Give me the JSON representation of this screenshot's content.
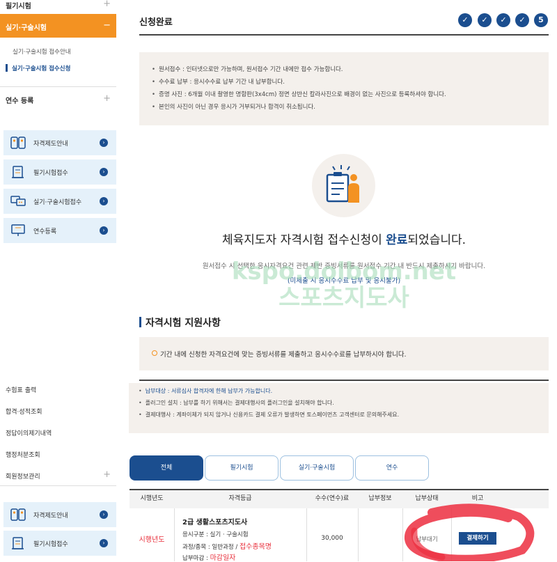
{
  "sidebar": {
    "written_exam": "필기시험",
    "practical_exam": "실기·구술시험",
    "practical_collapse": "−",
    "sub_guide": "실기·구술시험 접수안내",
    "sub_apply": "실기·구술시험 접수신청",
    "training_reg": "연수 등록",
    "cards": [
      {
        "label": "자격제도안내",
        "icon": "id-card-icon"
      },
      {
        "label": "필기시험접수",
        "icon": "document-icon"
      },
      {
        "label": "실기·구술시험접수",
        "icon": "chat-icon"
      },
      {
        "label": "연수등록",
        "icon": "monitor-icon"
      }
    ],
    "links": [
      "수험표 출력",
      "합격·성적조회",
      "정답이의제기내역",
      "행정처분조회",
      "회원정보관리"
    ],
    "cards2": [
      {
        "label": "자격제도안내",
        "icon": "id-card-icon"
      },
      {
        "label": "필기시험접수",
        "icon": "document-icon"
      }
    ]
  },
  "header": {
    "title": "신청완료",
    "steps": [
      "✓",
      "✓",
      "✓",
      "✓",
      "5"
    ]
  },
  "notice": [
    "원서접수 : 인터넷으로만 가능하며, 원서접수 기간 내에만 접수 가능합니다.",
    "수수료 납부 : 응시수수료 납부 기간 내 납부합니다.",
    "증명 사진 : 6개월 이내 촬영한 명함판(3x4cm) 정면 상반신 칼라사진으로 배경이 없는 사진으로 등록하셔야 합니다.",
    "본인의 사진이 아닌 경우 응시가 거부되거나 합격이 취소됩니다."
  ],
  "complete": {
    "pre": "체육지도자 자격시험 접수신청이 ",
    "highlight": "완료",
    "post": "되었습니다.",
    "desc": "원서접수 시 선택한 응시자격요건 관련 제반 증빙서류를 원서접수 기간 내 반드시 제출하시기 바랍니다.",
    "warn": "(미제출 시 응시수수료 납부 및 응시불가)"
  },
  "watermark": {
    "line1": "kspo.dolbom.net",
    "line2": "스포츠지도사"
  },
  "section": {
    "title": "자격시험 지원사항",
    "notice": "기간 내에 신청한 자격요건에 맞는 증빙서류를 제출하고 응시수수료를 납부하시야 합니다."
  },
  "notice2": [
    "납부대상 : 서류심사 합격자에 한해 납부가 가능합니다.",
    "플러그인 설치 : 납부를 하기 위해서는 결제대행사의 플러그인을 설치해야 합니다.",
    "결제대행사 : 계좌이체가 되지 않거나 신용카드 결제 오류가 발생하면 토스페이먼츠 고객센터로 문의해주세요."
  ],
  "tabs": [
    "전체",
    "필기시험",
    "실기·구술시험",
    "연수"
  ],
  "table": {
    "headers": [
      "시행년도",
      "자격등급",
      "수수(연수)료",
      "납부정보",
      "납부상태",
      "비고"
    ],
    "row": {
      "year": "시행년도",
      "grade": "2급 생활스포츠지도사",
      "type": "응시구분 : 실기 · 구술시험",
      "course_label": "과정/종목 : 일반과정 / ",
      "course_value": "접수종목명",
      "deadline_label": "납부마감 : ",
      "deadline_value": "마감일자",
      "fee": "30,000",
      "status": "납부대기",
      "pay_button": "결제하기"
    }
  },
  "colors": {
    "accent": "#1b4e8f",
    "orange": "#f39222",
    "red": "#e8303c"
  }
}
